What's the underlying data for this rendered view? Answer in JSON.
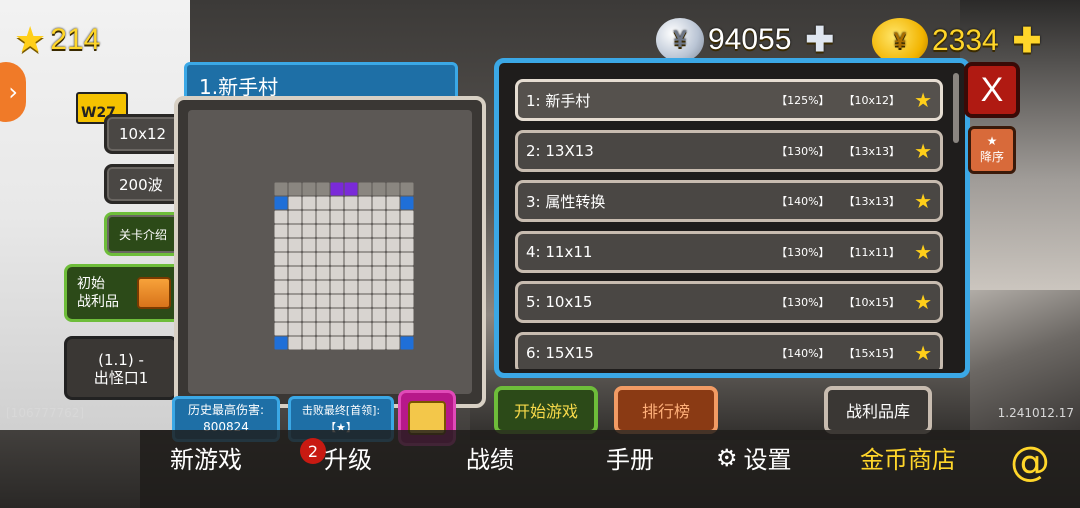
{
  "topbar": {
    "stars": "214",
    "coins": "94055",
    "gold": "2334",
    "coin_glyph": "¥",
    "gold_glyph": "¥",
    "plus": "✚"
  },
  "side_tab_arrow": "›",
  "w_badge": "W27",
  "left_info": {
    "map_size": "10x12",
    "waves": "200波",
    "level_intro": "关卡介绍",
    "initial_loot": "初始\n战利品",
    "spawn_line1": "(1.1) -",
    "spawn_line2": "出怪口1"
  },
  "level_title": "1.新手村",
  "level_list": [
    {
      "name": "1: 新手村",
      "pct": "【125%】",
      "size": "【10x12】"
    },
    {
      "name": "2: 13X13",
      "pct": "【130%】",
      "size": "【13x13】"
    },
    {
      "name": "3: 属性转换",
      "pct": "【140%】",
      "size": "【13x13】"
    },
    {
      "name": "4: 11x11",
      "pct": "【130%】",
      "size": "【11x11】"
    },
    {
      "name": "5: 10x15",
      "pct": "【130%】",
      "size": "【10x15】"
    },
    {
      "name": "6: 15X15",
      "pct": "【140%】",
      "size": "【15x15】"
    }
  ],
  "close_label": "X",
  "sort": {
    "icon": "★",
    "label": "降序"
  },
  "stats": {
    "max_damage_label": "历史最高伤害:",
    "max_damage_value": "800824",
    "defeat_label": "击败最终[首领]:",
    "defeat_value": "【★】"
  },
  "buttons": {
    "start": "开始游戏",
    "rank": "排行榜",
    "loot": "战利品库"
  },
  "player_id": "[106777762]",
  "version": "1.241012.17",
  "nav": {
    "new_game": "新游戏",
    "upgrade": "升级",
    "upgrade_badge": "2",
    "records": "战绩",
    "manual": "手册",
    "settings": "设置",
    "gold_shop": "金币商店",
    "at": "@"
  },
  "colors": {
    "accent_blue": "#3ba8e6",
    "accent_green": "#6ebd3a",
    "gold": "#ffd62a",
    "purple_cell": "#7a2ad8",
    "blue_cell": "#1f6fd8"
  }
}
